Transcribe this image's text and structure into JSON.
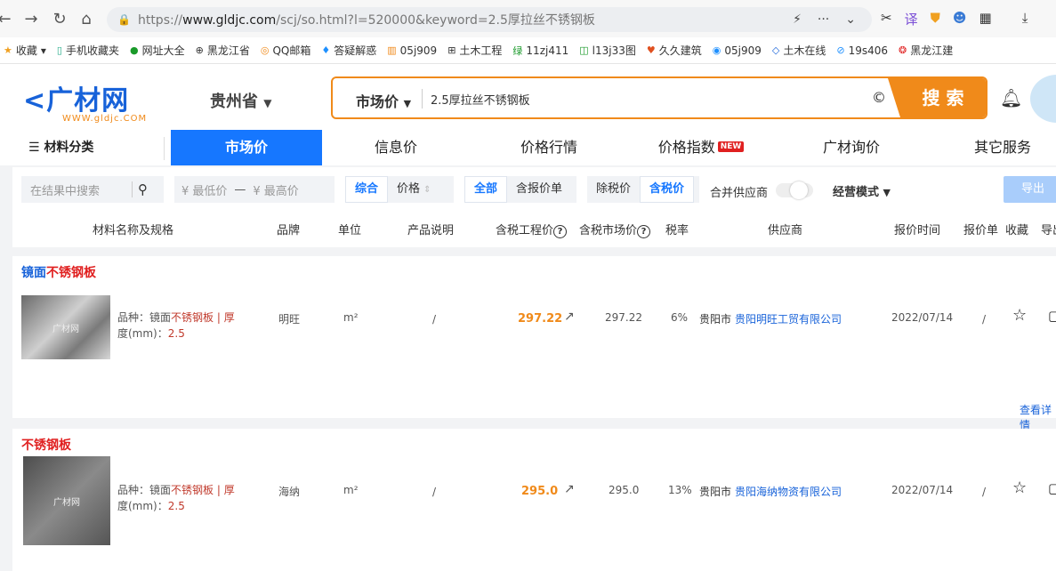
{
  "browser": {
    "url_prefix": "https://",
    "url_domain": "www.gldjc.com",
    "url_path": "/scj/so.html?l=520000&keyword=2.5厚拉丝不锈钢板"
  },
  "bookmarks": [
    "收藏",
    "手机收藏夹",
    "网址大全",
    "黑龙江省",
    "QQ邮箱",
    "答疑解惑",
    "05j909",
    "土木工程",
    "11zj411",
    "l13j33图",
    "久久建筑",
    "05j909",
    "土木在线",
    "19s406",
    "黑龙江建"
  ],
  "header": {
    "logo_main": "广材网",
    "logo_sub": "WWW.gldjc.COM",
    "province": "贵州省",
    "search_type": "市场价",
    "search_value": "2.5厚拉丝不锈钢板",
    "search_button": "搜 索"
  },
  "nav": {
    "category": "材料分类",
    "items": [
      "市场价",
      "信息价",
      "价格行情",
      "价格指数",
      "广材询价",
      "其它服务"
    ],
    "new_badge": "NEW"
  },
  "filter": {
    "search_placeholder": "在结果中搜索",
    "min_price": "¥ 最低价",
    "max_price": "¥ 最高价",
    "dash": "—",
    "sort_comprehensive": "综合",
    "sort_price": "价格",
    "scope_all": "全部",
    "scope_with_quote": "含报价单",
    "tax_exclusive": "除税价",
    "tax_inclusive": "含税价",
    "merge_suppliers": "合并供应商",
    "business_mode": "经营模式",
    "export": "导出"
  },
  "table": {
    "headers": [
      "材料名称及规格",
      "品牌",
      "单位",
      "产品说明",
      "含税工程价",
      "含税市场价",
      "税率",
      "供应商",
      "报价时间",
      "报价单",
      "收藏",
      "导出"
    ]
  },
  "rows": [
    {
      "title_prefix": "镜面",
      "title_hl": "不锈钢板",
      "thumb_text": "广材网",
      "spec_label1": "品种：镜面",
      "spec_hl": "不锈钢板",
      "spec_sep": " | 厚",
      "spec_label2": "度(mm)：",
      "spec_val": "2.5",
      "brand": "明旺",
      "unit": "m²",
      "desc": "/",
      "eng_price": "297.22",
      "market_price": "297.22",
      "tax": "6%",
      "city": "贵阳市",
      "supplier": "贵阳明旺工贸有限公司",
      "date": "2022/07/14",
      "quote": "/",
      "more": "查看详情"
    },
    {
      "title_prefix": "",
      "title_hl": "不锈钢板",
      "thumb_text": "广材网",
      "spec_label1": "品种：镜面",
      "spec_hl": "不锈钢板",
      "spec_sep": " | 厚",
      "spec_label2": "度(mm)：",
      "spec_val": "2.5",
      "brand": "海纳",
      "unit": "m²",
      "desc": "/",
      "eng_price": "295.0",
      "market_price": "295.0",
      "tax": "13%",
      "city": "贵阳市",
      "supplier": "贵阳海纳物资有限公司",
      "date": "2022/07/14",
      "quote": "/"
    }
  ]
}
